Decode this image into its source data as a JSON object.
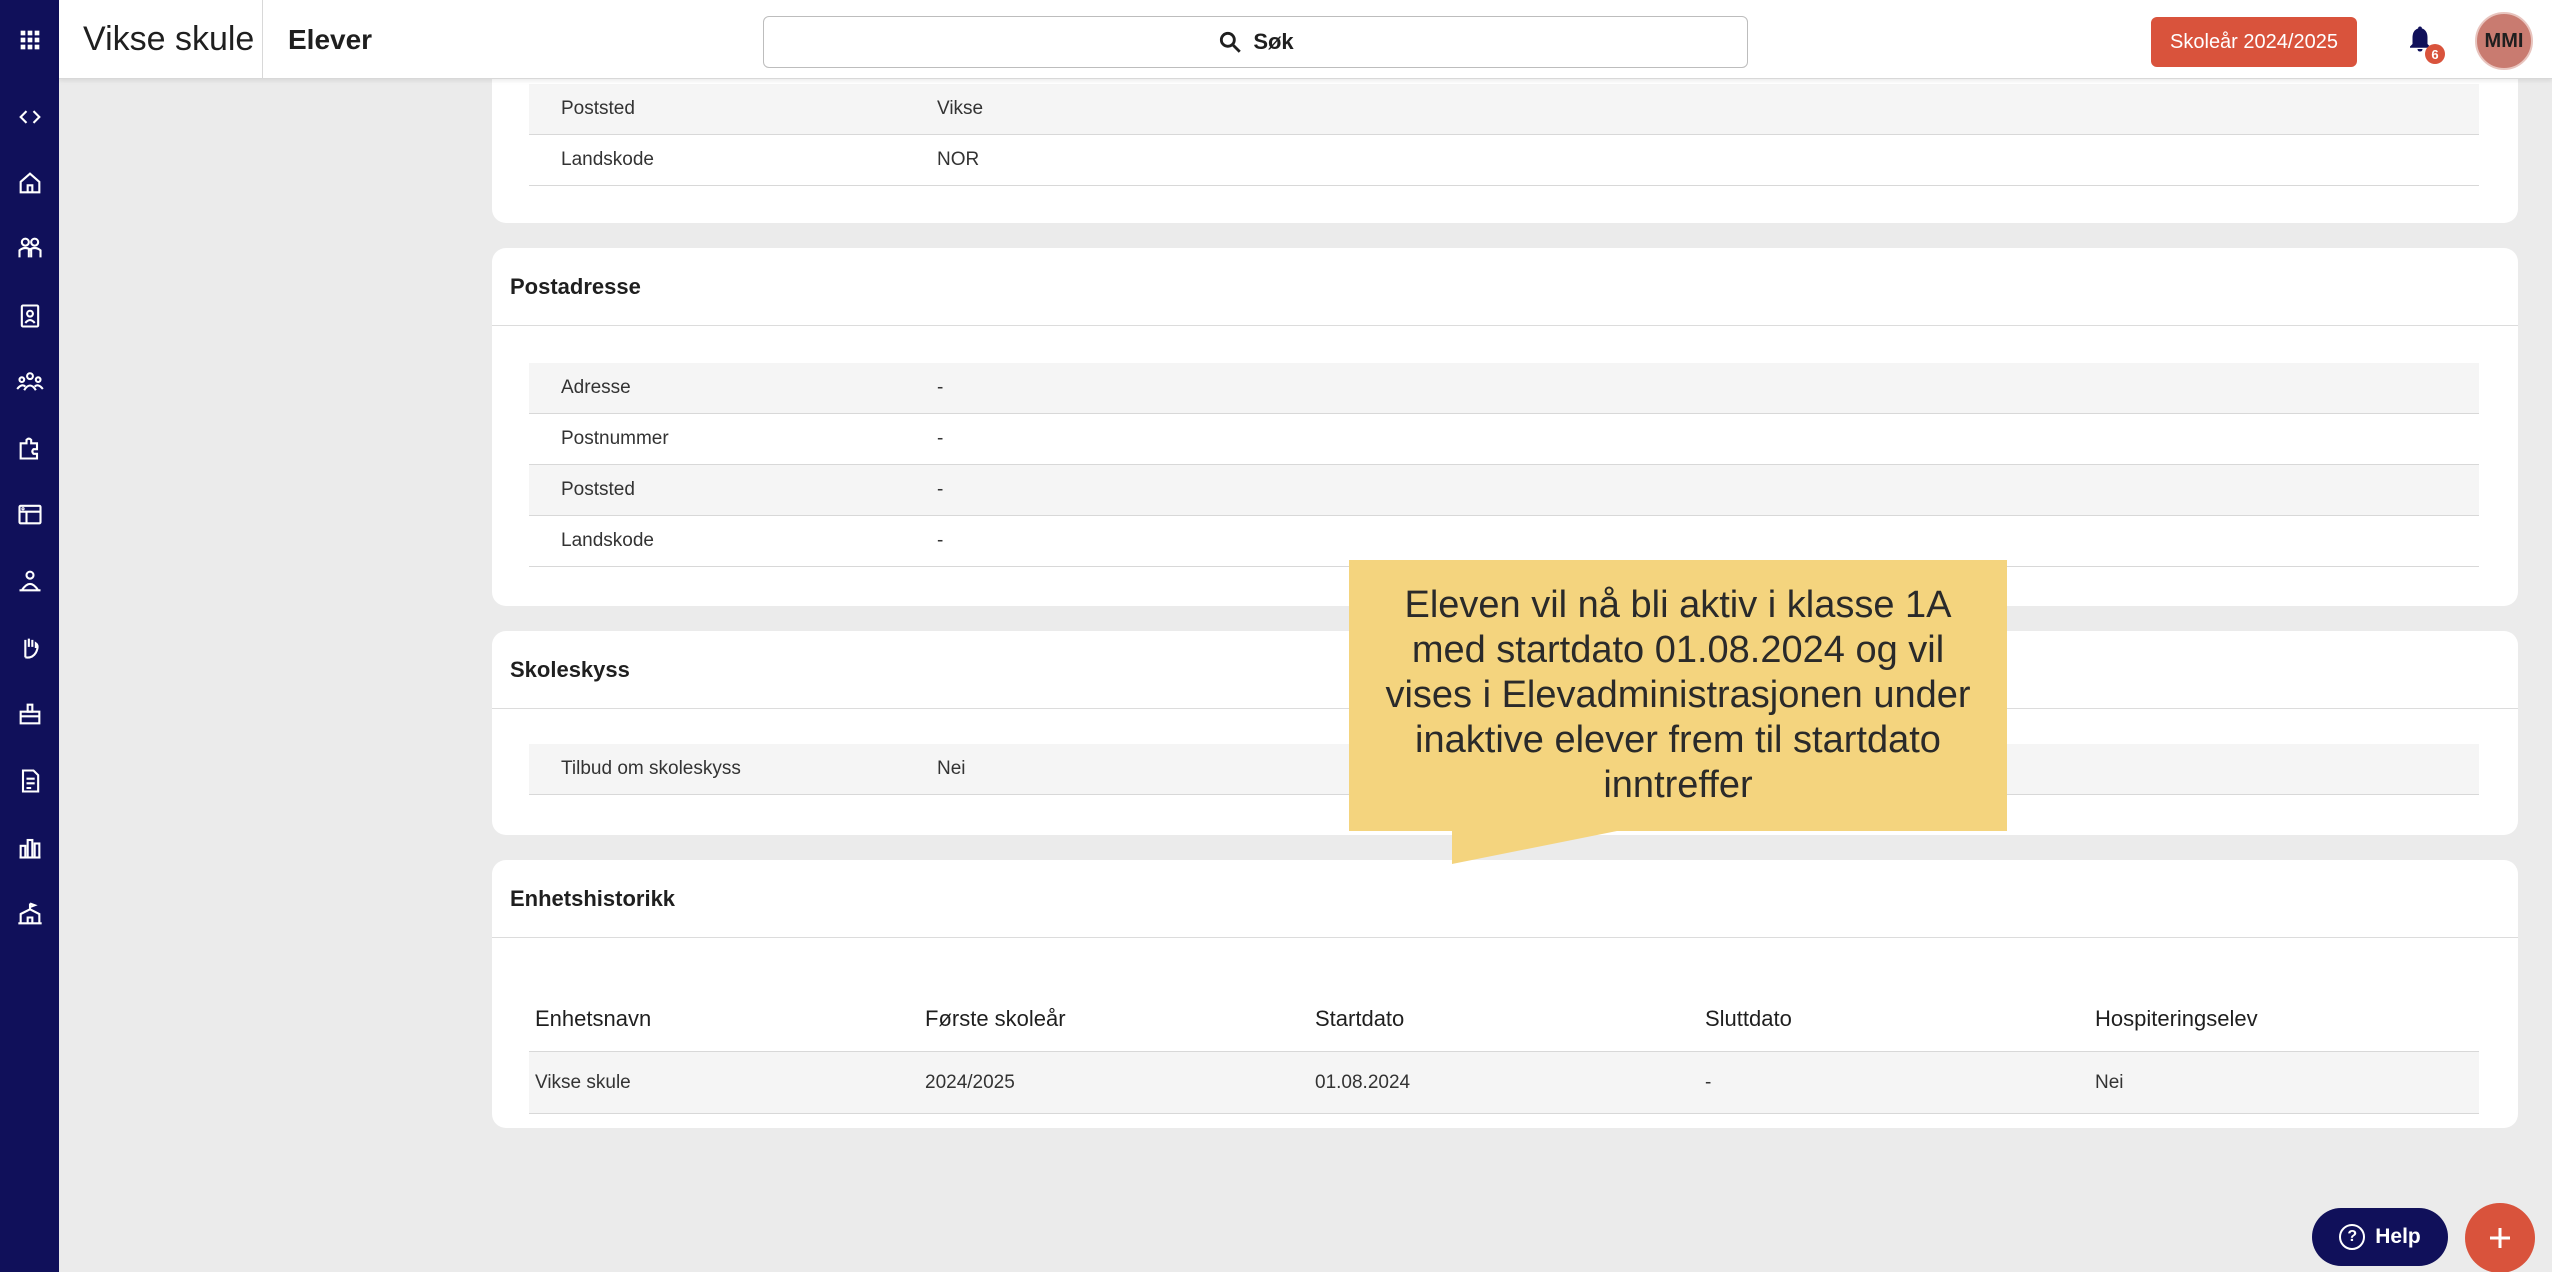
{
  "header": {
    "school_name": "Vikse skule",
    "page_name": "Elever",
    "search_label": "Søk",
    "school_year_button": "Skoleår 2024/2025",
    "notification_count": "6",
    "avatar_initials": "MMI"
  },
  "sidebar_icons": [
    "apps-grid-icon",
    "code-toggle-icon",
    "home-icon",
    "students-icon",
    "badge-icon",
    "groups-icon",
    "puzzle-icon",
    "timetable-icon",
    "teacher-icon",
    "hand-icon",
    "classroom-icon",
    "document-icon",
    "bar-chart-icon",
    "school-icon"
  ],
  "besoksadresse": {
    "rows": [
      {
        "label": "Poststed",
        "value": "Vikse"
      },
      {
        "label": "Landskode",
        "value": "NOR"
      }
    ]
  },
  "postadresse": {
    "title": "Postadresse",
    "rows": [
      {
        "label": "Adresse",
        "value": "-"
      },
      {
        "label": "Postnummer",
        "value": "-"
      },
      {
        "label": "Poststed",
        "value": "-"
      },
      {
        "label": "Landskode",
        "value": "-"
      }
    ]
  },
  "skoleskyss": {
    "title": "Skoleskyss",
    "rows": [
      {
        "label": "Tilbud om skoleskyss",
        "value": "Nei"
      }
    ]
  },
  "enhetshistorikk": {
    "title": "Enhetshistorikk",
    "columns": [
      "Enhetsnavn",
      "Første skoleår",
      "Startdato",
      "Sluttdato",
      "Hospiteringselev"
    ],
    "rows": [
      [
        "Vikse skule",
        "2024/2025",
        "01.08.2024",
        "-",
        "Nei"
      ]
    ]
  },
  "callout": {
    "text": "Eleven vil nå bli aktiv i klasse 1A med startdato 01.08.2024 og vil vises i Elevadministrasjonen under inaktive elever frem til startdato inntreffer"
  },
  "floating": {
    "help_label": "Help"
  },
  "colors": {
    "rail": "#10105a",
    "accent": "#d9533c",
    "callout": "#f4d47e"
  }
}
